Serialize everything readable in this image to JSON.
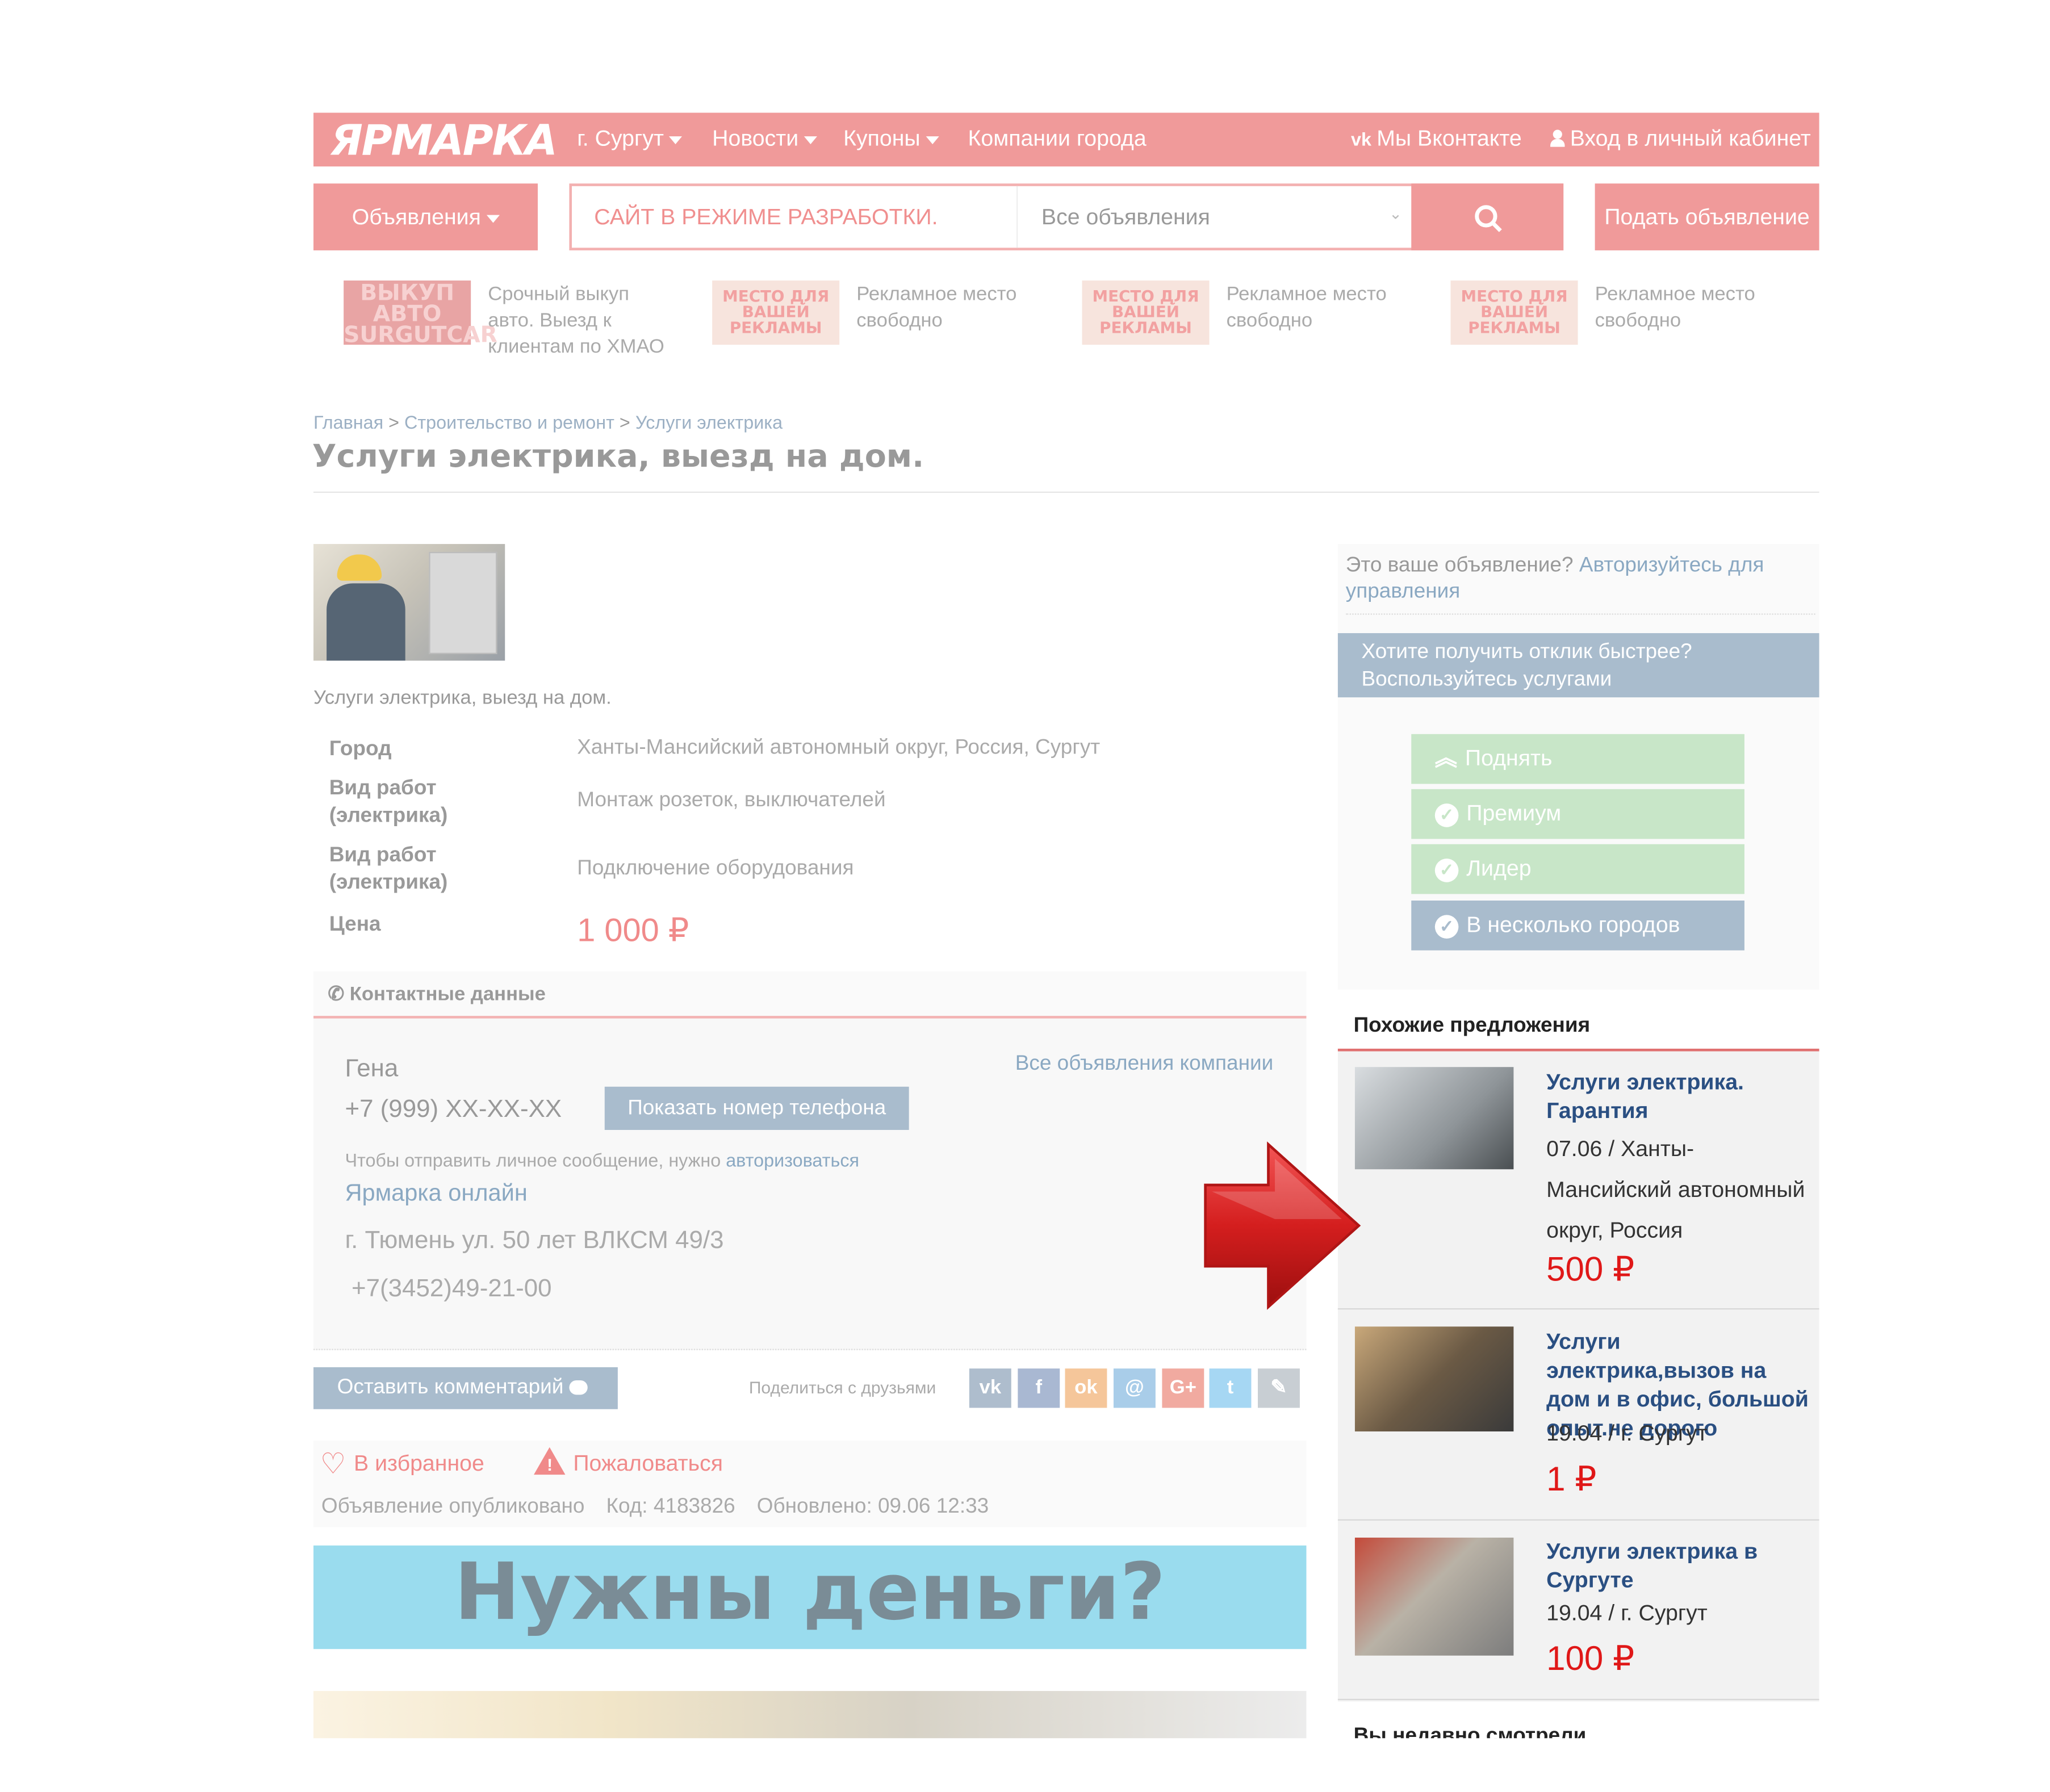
{
  "header": {
    "logo": "ЯРМАРКА",
    "city": "г. Сургут",
    "news": "Новости",
    "coupons": "Купоны",
    "companies": "Компании города",
    "vk": "Мы Вконтакте",
    "login": "Вход в личный кабинет"
  },
  "searchbar": {
    "category_button": "Объявления",
    "search_placeholder": "САЙТ В РЕЖИМЕ РАЗРАБОТКИ.",
    "select_value": "Все объявления",
    "submit_ad": "Подать объявление"
  },
  "ads": [
    {
      "img": "ВЫКУП АВТО SURGUTCAR",
      "text": "Срочный выкуп авто. Выезд к клиентам по ХМАО"
    },
    {
      "img": "МЕСТО ДЛЯ ВАШЕЙ РЕКЛАМЫ",
      "text": "Рекламное место свободно"
    },
    {
      "img": "МЕСТО ДЛЯ ВАШЕЙ РЕКЛАМЫ",
      "text": "Рекламное место свободно"
    },
    {
      "img": "МЕСТО ДЛЯ ВАШЕЙ РЕКЛАМЫ",
      "text": "Рекламное место свободно"
    }
  ],
  "breadcrumb": {
    "home": "Главная",
    "sep": ">",
    "category": "Строительство и ремонт",
    "subcategory": "Услуги электрика"
  },
  "page_title": "Услуги электрика, выезд на дом.",
  "listing": {
    "description": "Услуги электрика, выезд на дом.",
    "fields": [
      {
        "label": "Город",
        "value": "Ханты-Мансийский автономный округ, Россия, Сургут"
      },
      {
        "label": "Вид работ (электрика)",
        "value": "Монтаж розеток, выключателей"
      },
      {
        "label": "Вид работ (электрика)",
        "value": "Подключение оборудования"
      },
      {
        "label": "Цена",
        "value": "1 000 ₽"
      }
    ]
  },
  "contacts": {
    "title": "Контактные данные",
    "name": "Гена",
    "phone": "+7 (999) XX-XX-XX",
    "show_phone": "Показать номер телефона",
    "all_company_ads": "Все объявления компании",
    "message_note": "Чтобы отправить личное сообщение, нужно",
    "message_link": "авторизоваться",
    "company": "Ярмарка онлайн",
    "address": "г. Тюмень ул. 50 лет ВЛКСМ 49/3",
    "company_phone": "+7(3452)49-21-00"
  },
  "actions": {
    "comment": "Оставить комментарий",
    "share": "Поделиться с друзьями",
    "favorite": "В избранное",
    "report": "Пожаловаться",
    "published": "Объявление опубликовано",
    "code": "Код: 4183826",
    "updated": "Обновлено: 09.06 12:33"
  },
  "social": [
    {
      "icon": "vk-icon",
      "glyph": "vk",
      "color": "#aebdcd"
    },
    {
      "icon": "facebook-icon",
      "glyph": "f",
      "color": "#a9b8d2"
    },
    {
      "icon": "odnoklassniki-icon",
      "glyph": "ok",
      "color": "#f5c69a"
    },
    {
      "icon": "moimir-icon",
      "glyph": "@",
      "color": "#a9cde9"
    },
    {
      "icon": "googleplus-icon",
      "glyph": "G+",
      "color": "#f1aaa0"
    },
    {
      "icon": "twitter-icon",
      "glyph": "t",
      "color": "#a6d7f3"
    },
    {
      "icon": "livejournal-icon",
      "glyph": "✎",
      "color": "#c8ced3"
    }
  ],
  "banner": "Нужны деньги?",
  "sidebar": {
    "owner_text": "Это ваше объявление?",
    "owner_link": "Авторизуйтесь для управления",
    "promo_title": "Хотите получить отклик быстрее? Воспользуйтесь услугами",
    "promo": [
      "Поднять",
      "Премиум",
      "Лидер",
      "В несколько городов"
    ],
    "similar_title": "Похожие предложения",
    "similar": [
      {
        "title": "Услуги электрика. Гарантия",
        "meta": "07.06 / Ханты-Мансийский автономный округ, Россия",
        "price": "500 ₽"
      },
      {
        "title": "Услуги электрика,вызов на дом и в офис, большой опыт.не дорого",
        "meta": "19.04 / г. Сургут",
        "price": "1 ₽"
      },
      {
        "title": "Услуги электрика в Сургуте",
        "meta": "19.04 / г. Сургут",
        "price": "100 ₽"
      }
    ],
    "viewed_title": "Вы недавно смотрели"
  },
  "colors": {
    "brand": "#f09a9a",
    "link": "#8aa8c2",
    "price": "#e01818",
    "arrow": "#d41e1e"
  }
}
